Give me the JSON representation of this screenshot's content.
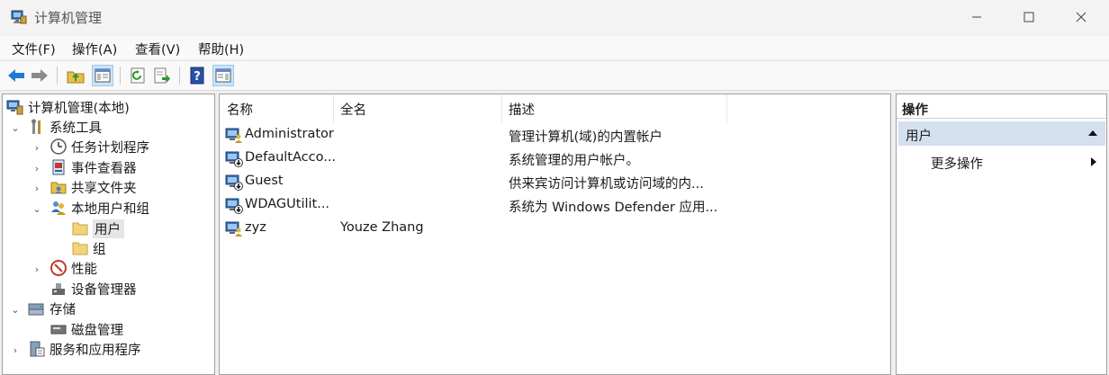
{
  "window": {
    "title": "计算机管理",
    "controls": {
      "minimize": "—",
      "maximize": "☐",
      "close": "✕"
    }
  },
  "menu": [
    "文件(F)",
    "操作(A)",
    "查看(V)",
    "帮助(H)"
  ],
  "toolbar": [
    "back-icon",
    "forward-icon",
    "up-folder-icon",
    "show-hide-tree-icon",
    "refresh-icon",
    "export-list-icon",
    "help-icon",
    "show-action-pane-icon"
  ],
  "tree": {
    "root": "计算机管理(本地)",
    "system_tools": "系统工具",
    "task_scheduler": "任务计划程序",
    "event_viewer": "事件查看器",
    "shared_folders": "共享文件夹",
    "local_users_groups": "本地用户和组",
    "users": "用户",
    "groups": "组",
    "performance": "性能",
    "device_manager": "设备管理器",
    "storage": "存储",
    "disk_management": "磁盘管理",
    "services_apps": "服务和应用程序"
  },
  "list": {
    "columns": [
      "名称",
      "全名",
      "描述"
    ],
    "rows": [
      {
        "name": "Administrator",
        "full_name": "",
        "description": "管理计算机(域)的内置帐户",
        "disabled": false
      },
      {
        "name": "DefaultAcco...",
        "full_name": "",
        "description": "系统管理的用户帐户。",
        "disabled": true
      },
      {
        "name": "Guest",
        "full_name": "",
        "description": "供来宾访问计算机或访问域的内...",
        "disabled": true
      },
      {
        "name": "WDAGUtilit...",
        "full_name": "",
        "description": "系统为 Windows Defender 应用...",
        "disabled": true
      },
      {
        "name": "zyz",
        "full_name": "Youze Zhang",
        "description": "",
        "disabled": false
      }
    ]
  },
  "actions": {
    "title": "操作",
    "section": "用户",
    "more": "更多操作"
  },
  "colors": {
    "selection": "#cce4f7",
    "action_section": "#d4dff0",
    "window_bg": "#f0f0f0"
  }
}
